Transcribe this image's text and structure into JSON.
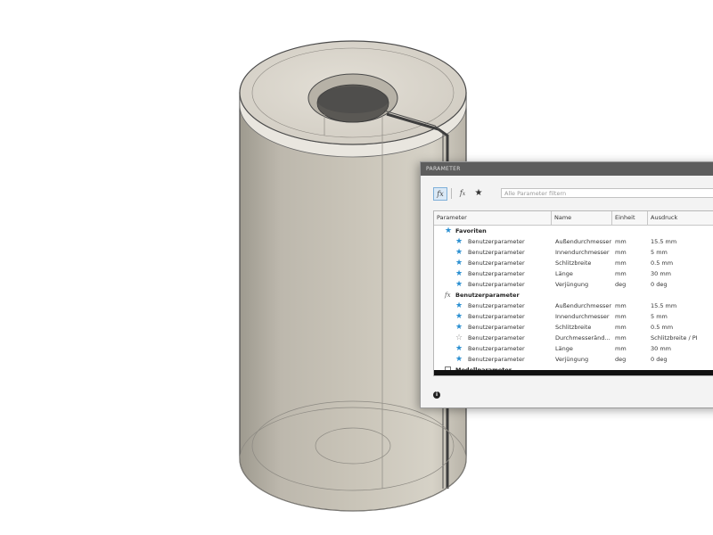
{
  "dialog": {
    "title": "PARAMETER",
    "filter_placeholder": "Alle Parameter filtern",
    "columns": [
      "Parameter",
      "Name",
      "Einheit",
      "Ausdruck"
    ],
    "groups": [
      {
        "label": "Favoriten",
        "icon": "star-icon",
        "rows": [
          {
            "parameter": "Benutzerparameter",
            "name": "Außendurchmesser",
            "unit": "mm",
            "expression": "15.5 mm",
            "favorite": true
          },
          {
            "parameter": "Benutzerparameter",
            "name": "Innendurchmesser",
            "unit": "mm",
            "expression": "5 mm",
            "favorite": true
          },
          {
            "parameter": "Benutzerparameter",
            "name": "Schlitzbreite",
            "unit": "mm",
            "expression": "0.5 mm",
            "favorite": true
          },
          {
            "parameter": "Benutzerparameter",
            "name": "Länge",
            "unit": "mm",
            "expression": "30 mm",
            "favorite": true
          },
          {
            "parameter": "Benutzerparameter",
            "name": "Verjüngung",
            "unit": "deg",
            "expression": "0 deg",
            "favorite": true
          }
        ]
      },
      {
        "label": "Benutzerparameter",
        "icon": "fx-icon",
        "rows": [
          {
            "parameter": "Benutzerparameter",
            "name": "Außendurchmesser",
            "unit": "mm",
            "expression": "15.5 mm",
            "favorite": true
          },
          {
            "parameter": "Benutzerparameter",
            "name": "Innendurchmesser",
            "unit": "mm",
            "expression": "5 mm",
            "favorite": true
          },
          {
            "parameter": "Benutzerparameter",
            "name": "Schlitzbreite",
            "unit": "mm",
            "expression": "0.5 mm",
            "favorite": true
          },
          {
            "parameter": "Benutzerparameter",
            "name": "Durchmesseränd...",
            "unit": "mm",
            "expression": "Schlitzbreite / PI",
            "favorite": false
          },
          {
            "parameter": "Benutzerparameter",
            "name": "Länge",
            "unit": "mm",
            "expression": "30 mm",
            "favorite": true
          },
          {
            "parameter": "Benutzerparameter",
            "name": "Verjüngung",
            "unit": "deg",
            "expression": "0 deg",
            "favorite": true
          }
        ]
      },
      {
        "label": "Modellparameter",
        "icon": "box-icon",
        "rows": []
      }
    ]
  },
  "colors": {
    "favorite_star": "#2a8fd1",
    "titlebar": "#5d5d5d",
    "model": "#c9c4b8"
  }
}
